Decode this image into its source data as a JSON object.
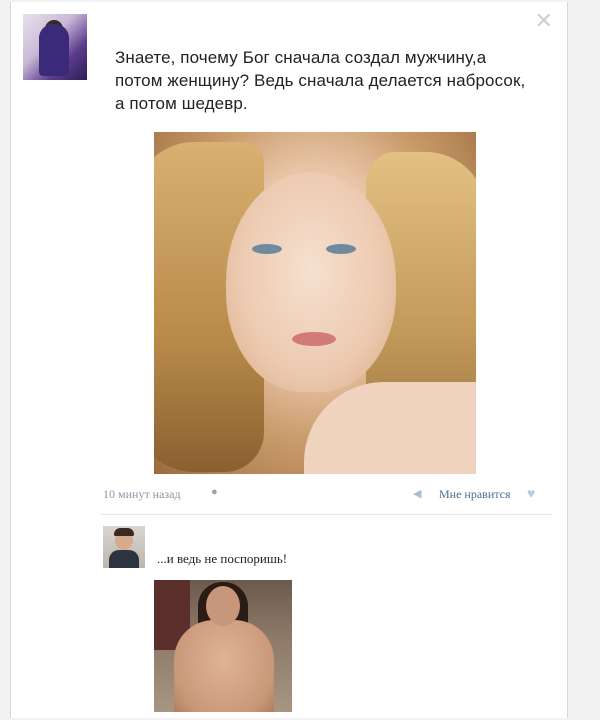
{
  "post": {
    "text": "Знаете, почему Бог сначала создал мужчину,а потом женщину? Ведь сначала делается набросок, а потом шедевр.",
    "time": "10 минут назад",
    "like_label": "Мне нравится"
  },
  "reply": {
    "author": "",
    "text": "...и ведь не поспоришь!"
  },
  "icons": {
    "close": "close-icon",
    "platform": "apple-icon",
    "share": "megaphone-icon",
    "like": "heart-icon"
  },
  "colors": {
    "link": "#4e6f93",
    "meta": "#8a95a3",
    "text": "#222222"
  }
}
